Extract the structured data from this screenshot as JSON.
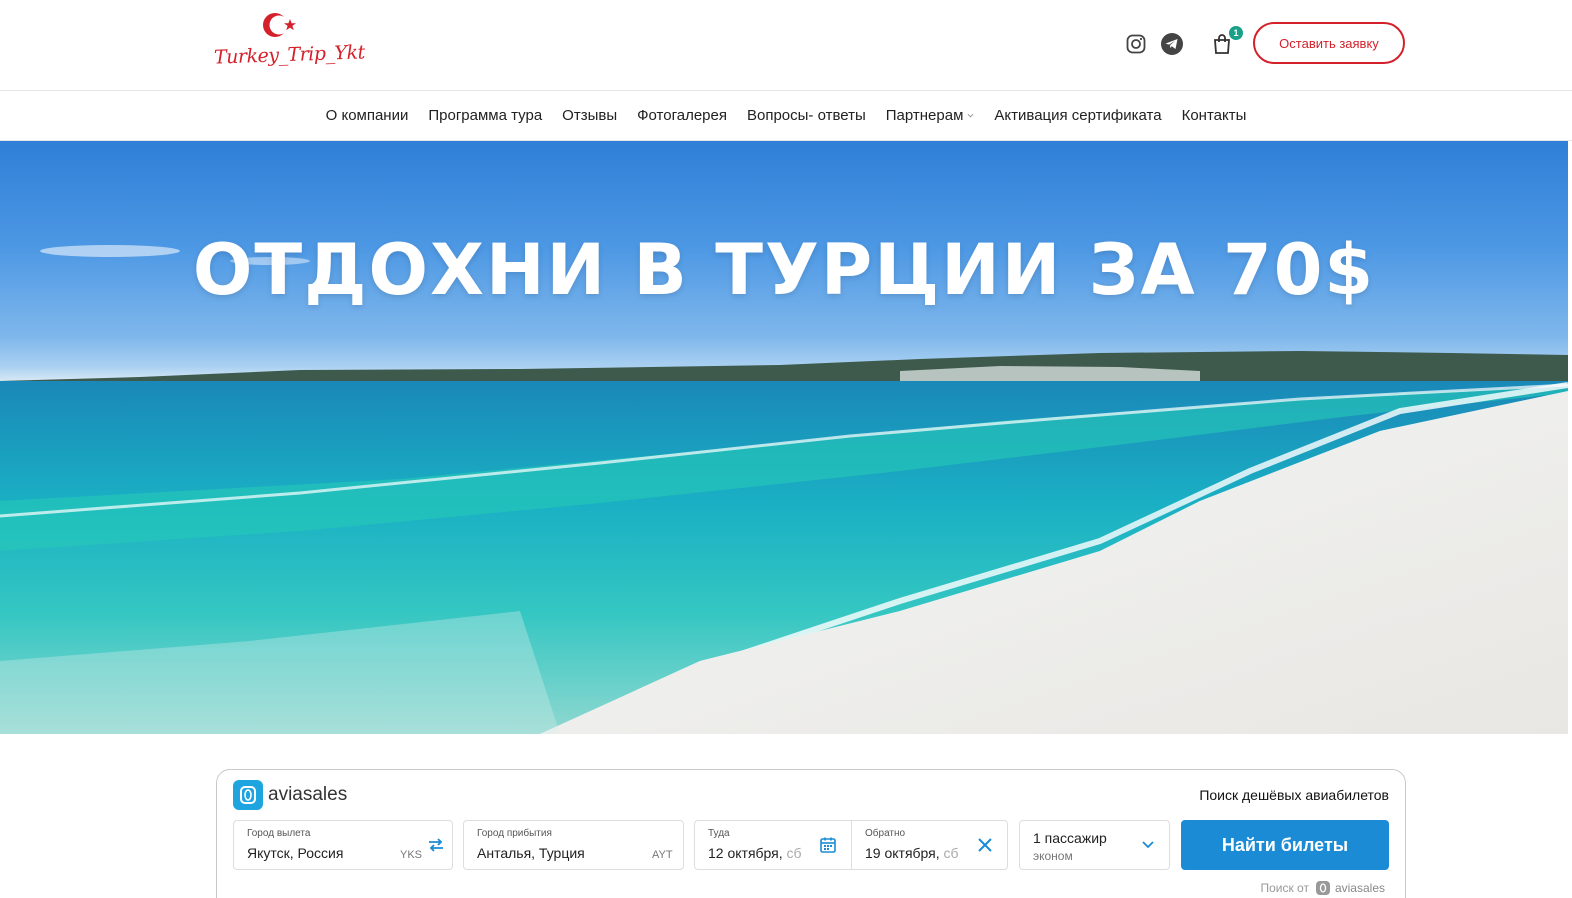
{
  "header": {
    "logo_text": "Turkey_Trip_Ykt",
    "icons": [
      "instagram-icon",
      "telegram-icon",
      "shopping-bag-icon"
    ],
    "cart_count": "1",
    "cta_label": "Оставить заявку",
    "brand_color": "#d4202a",
    "badge_color": "#18a089"
  },
  "nav": {
    "items": [
      {
        "label": "О компании"
      },
      {
        "label": "Программа тура"
      },
      {
        "label": "Отзывы"
      },
      {
        "label": "Фотогалерея"
      },
      {
        "label": "Вопросы- ответы"
      },
      {
        "label": "Партнерам"
      },
      {
        "label": "Активация сертификата"
      },
      {
        "label": "Контакты"
      }
    ]
  },
  "hero": {
    "title": "ОТДОХНИ В ТУРЦИИ ЗА 70$"
  },
  "search": {
    "brand": "aviasales",
    "tagline": "Поиск дешёвых авиабилетов",
    "origin": {
      "label": "Город вылета",
      "value": "Якутск, Россия",
      "code": "YKS"
    },
    "destination": {
      "label": "Город прибытия",
      "value": "Анталья, Турция",
      "code": "AYT"
    },
    "depart": {
      "label": "Туда",
      "value": "12 октября,",
      "weekday": "сб"
    },
    "return": {
      "label": "Обратно",
      "value": "19 октября,",
      "weekday": "сб"
    },
    "passengers": {
      "value": "1 пассажир",
      "class": "эконом"
    },
    "submit_label": "Найти билеты",
    "powered_prefix": "Поиск от",
    "powered_brand": "aviasales",
    "accent_color": "#1b8bd5"
  }
}
